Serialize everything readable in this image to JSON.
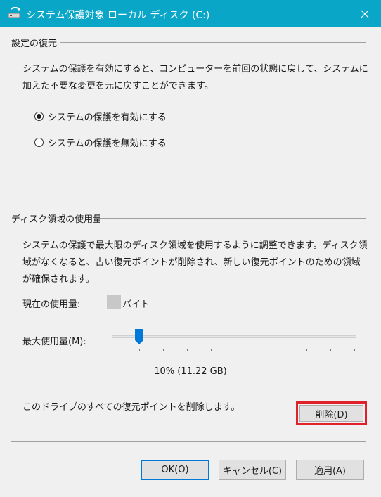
{
  "window": {
    "title": "システム保護対象 ローカル ディスク (C:)",
    "icons": {
      "app": "system-protection-icon",
      "close": "close-icon"
    },
    "titlebar_color": "#0aa6c8"
  },
  "restore_settings": {
    "header": "設定の復元",
    "description": "システムの保護を有効にすると、コンピューターを前回の状態に戻して、システムに加えた不要な変更を元に戻すことができます。",
    "options": [
      {
        "label": "システムの保護を有効にする",
        "selected": true
      },
      {
        "label": "システムの保護を無効にする",
        "selected": false
      }
    ]
  },
  "disk_usage": {
    "header": "ディスク領域の使用量",
    "description": "システムの保護で最大限のディスク領域を使用するように調整できます。ディスク領域がなくなると、古い復元ポイントが削除され、新しい復元ポイントのための領域が確保されます。",
    "current_usage_label": "現在の使用量:",
    "current_usage_unit": "バイト",
    "max_usage_label": "最大使用量(M):",
    "slider_value_percent": 10,
    "slider_readout": "10% (11.22 GB)",
    "delete_description": "このドライブのすべての復元ポイントを削除します。",
    "delete_button": "削除(D)"
  },
  "footer": {
    "ok": "OK(O)",
    "cancel": "キャンセル(C)",
    "apply": "適用(A)"
  },
  "colors": {
    "accent": "#0078d7",
    "highlight": "#e0202b"
  }
}
